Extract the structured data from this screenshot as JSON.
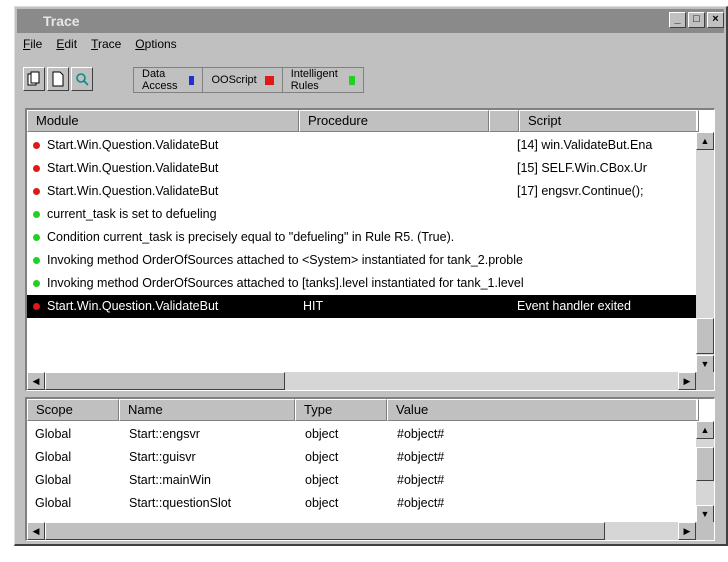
{
  "window": {
    "title": "Trace",
    "controls": [
      "_",
      "□",
      "×"
    ]
  },
  "menu": [
    "File",
    "Edit",
    "Trace",
    "Options"
  ],
  "toolbar": {
    "buttons": [
      {
        "icon": "copy-icon"
      },
      {
        "icon": "new-page-icon"
      },
      {
        "icon": "find-icon"
      }
    ],
    "legend": [
      {
        "label": "Data Access",
        "color": "#1f2fd8"
      },
      {
        "label": "OOScript",
        "color": "#e01818"
      },
      {
        "label": "Intelligent Rules",
        "color": "#22d022"
      }
    ]
  },
  "trace_panel": {
    "columns": [
      "Module",
      "Procedure",
      "Script"
    ],
    "rows": [
      {
        "color": "#e01818",
        "module": "Start.Win.Question.ValidateBut",
        "procedure": "",
        "script": "[14]  win.ValidateBut.Ena"
      },
      {
        "color": "#e01818",
        "module": "Start.Win.Question.ValidateBut",
        "procedure": "",
        "script": "[15]  SELF.Win.CBox.Ur"
      },
      {
        "color": "#e01818",
        "module": "Start.Win.Question.ValidateBut",
        "procedure": "",
        "script": "[17]  engsvr.Continue();"
      },
      {
        "color": "#22d022",
        "message": "current_task is set to defueling"
      },
      {
        "color": "#22d022",
        "message": "Condition current_task is precisely equal to \"defueling\" in Rule R5. (True)."
      },
      {
        "color": "#22d022",
        "message": "Invoking method OrderOfSources attached to <System> instantiated for tank_2.proble"
      },
      {
        "color": "#22d022",
        "message": "Invoking method OrderOfSources attached to [tanks].level instantiated for tank_1.level"
      },
      {
        "color": "#e01818",
        "module": "Start.Win.Question.ValidateBut",
        "procedure": "HIT",
        "script": "Event handler exited",
        "selected": true
      }
    ]
  },
  "vars_panel": {
    "columns": [
      "Scope",
      "Name",
      "Type",
      "Value"
    ],
    "rows": [
      {
        "scope": "Global",
        "name": "Start::engsvr",
        "type": "object",
        "value": "#object#"
      },
      {
        "scope": "Global",
        "name": "Start::guisvr",
        "type": "object",
        "value": "#object#"
      },
      {
        "scope": "Global",
        "name": "Start::mainWin",
        "type": "object",
        "value": "#object#"
      },
      {
        "scope": "Global",
        "name": "Start::questionSlot",
        "type": "object",
        "value": "#object#"
      }
    ]
  }
}
